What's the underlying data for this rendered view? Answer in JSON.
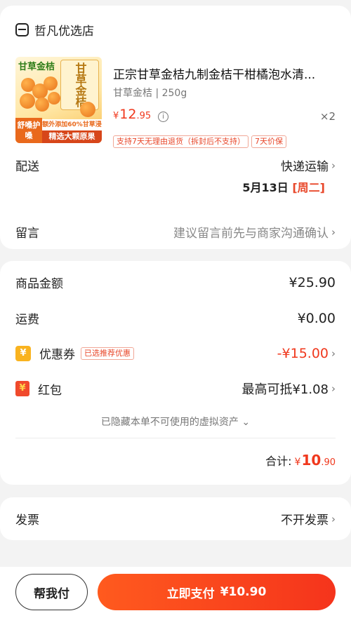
{
  "store": {
    "name": "哲凡优选店"
  },
  "product": {
    "image": {
      "title": "甘草金桔",
      "box_text": "甘草金桔",
      "side_text": "舒嗓护嗓",
      "band_text": "额外添加60%甘草浸",
      "foot_text": "精选大颗原果"
    },
    "title": "正宗甘草金桔九制金桔干柑橘泡水清...",
    "spec": "甘草金桔 | 250g",
    "price": {
      "currency": "¥",
      "integer": "12",
      "decimal": ".95"
    },
    "quantity": "×2",
    "tags": [
      "支持7天无理由退货（拆封后不支持）",
      "7天价保"
    ]
  },
  "delivery": {
    "label": "配送",
    "method": "快递运输",
    "date": "5月13日",
    "weekday": "[周二]"
  },
  "message": {
    "label": "留言",
    "placeholder": "建议留言前先与商家沟通确认"
  },
  "amounts": {
    "goods_label": "商品金额",
    "goods_value": "¥25.90",
    "shipping_label": "运费",
    "shipping_value": "¥0.00",
    "coupon_label": "优惠券",
    "coupon_badge": "已选推荐优惠",
    "coupon_value": "-¥15.00",
    "redpack_label": "红包",
    "redpack_value": "最高可抵¥1.08",
    "hidden_note": "已隐藏本单不可使用的虚拟资产",
    "total_label": "合计:",
    "total_currency": "¥",
    "total_integer": "10",
    "total_decimal": ".90"
  },
  "invoice": {
    "label": "发票",
    "value": "不开发票"
  },
  "bottom": {
    "help_label": "帮我付",
    "pay_label": "立即支付",
    "pay_amount": "¥10.90"
  },
  "colors": {
    "accent": "#f0381d",
    "coupon_icon": "#f9b31f",
    "redpack_icon": "#f04a2c"
  }
}
